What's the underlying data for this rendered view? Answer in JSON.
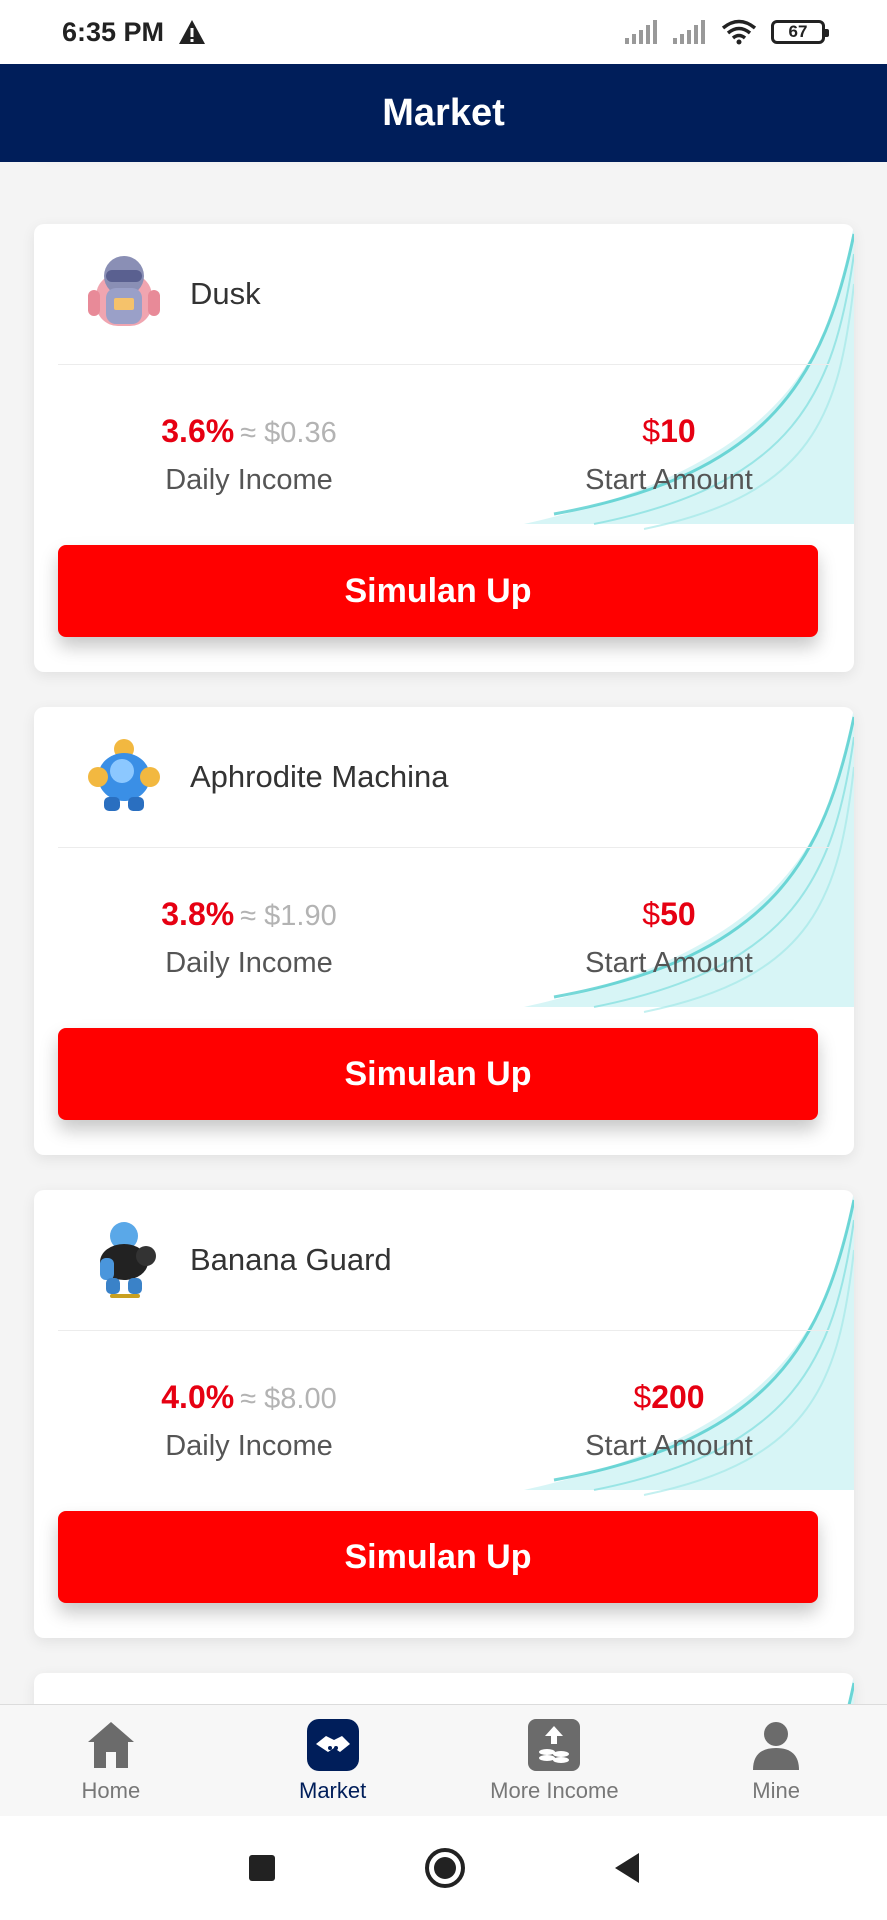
{
  "status_bar": {
    "time": "6:35 PM",
    "battery": "67",
    "icons": [
      "warning-icon",
      "signal-icon",
      "signal-icon",
      "wifi-icon",
      "battery-icon"
    ]
  },
  "header": {
    "title": "Market"
  },
  "products": [
    {
      "name": "Dusk",
      "rate": "3.6%",
      "approx": "≈ $0.36",
      "daily_label": "Daily Income",
      "currency": "$",
      "amount": "10",
      "start_label": "Start Amount",
      "button": "Simulan Up"
    },
    {
      "name": "Aphrodite Machina",
      "rate": "3.8%",
      "approx": "≈ $1.90",
      "daily_label": "Daily Income",
      "currency": "$",
      "amount": "50",
      "start_label": "Start Amount",
      "button": "Simulan Up"
    },
    {
      "name": "Banana Guard",
      "rate": "4.0%",
      "approx": "≈ $8.00",
      "daily_label": "Daily Income",
      "currency": "$",
      "amount": "200",
      "start_label": "Start Amount",
      "button": "Simulan Up"
    }
  ],
  "tabs": [
    {
      "label": "Home",
      "icon": "house-icon"
    },
    {
      "label": "Market",
      "icon": "handshake-icon",
      "active": true
    },
    {
      "label": "More Income",
      "icon": "coins-upload-icon"
    },
    {
      "label": "Mine",
      "icon": "person-icon"
    }
  ],
  "colors": {
    "header_bg": "#001e5a",
    "accent_red": "#e60012",
    "button_red": "#ff0000",
    "wave_teal": "#3cc8c8"
  }
}
